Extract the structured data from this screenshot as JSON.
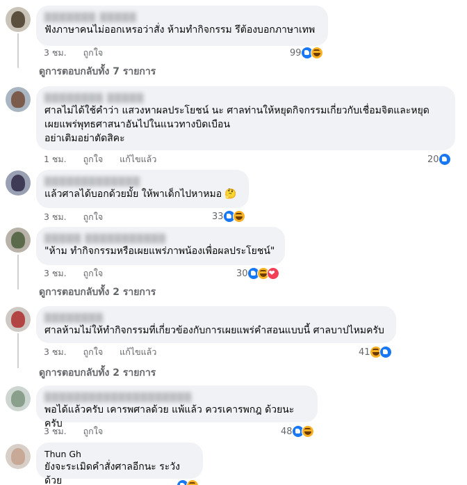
{
  "comments": [
    {
      "name": "▒▒▒▒▒▒▒ ▒▒▒▒▒",
      "text": "ฟังภาษาคนไม่ออกเหรอว่าสั่ง ห้ามทำกิจกรรม รึต้องบอกภาษาเทพ",
      "time": "3 ชม.",
      "like": "ถูกใจ",
      "edited": "",
      "reaction_count": "99",
      "reactions": [
        "like",
        "haha"
      ],
      "view_replies": "ดูการตอบกลับทั้ง 7 รายการ"
    },
    {
      "name": "▒▒▒▒▒▒▒▒ ▒▒▒▒▒",
      "text": "ศาลไม่ได้ใช้คำว่า แสวงหาผลประโยชน์ นะ ศาลท่านให้หยุดกิจกรรมเกี่ยวกับเชื่อมจิตและหยุด\nเผยแพร่พุทธศาสนาอันไปในแนวทางบิดเบือน\nอย่าเติมอย่าตัดสิคะ",
      "time": "1 ชม.",
      "like": "ถูกใจ",
      "edited": "แก้ไขแล้ว",
      "reaction_count": "20",
      "reactions": [
        "like"
      ],
      "view_replies": ""
    },
    {
      "name": "▒▒▒▒▒▒▒▒▒▒▒▒▒",
      "text": "แล้วศาลได้บอกด้วยมั้ย ให้พาเด็กไปหาหมอ",
      "time": "3 ชม.",
      "like": "ถูกใจ",
      "edited": "",
      "reaction_count": "33",
      "reactions": [
        "like",
        "haha"
      ],
      "view_replies": ""
    },
    {
      "name": "▒▒▒▒▒ ▒▒▒▒▒▒▒▒▒▒▒",
      "text": "\"ห้าม ทำกิจกรรมหรือเผยแพร่ภาพน้องเพื่อผลประโยชน์\"",
      "time": "3 ชม.",
      "like": "ถูกใจ",
      "edited": "",
      "reaction_count": "30",
      "reactions": [
        "like",
        "haha",
        "love"
      ],
      "view_replies": "ดูการตอบกลับทั้ง 2 รายการ"
    },
    {
      "name": "▒▒▒▒▒▒▒▒",
      "text": "ศาลห้ามไม่ให้ทำกิจกรรมที่เกี่ยวข้องกับการเผยแพร่คำสอนแบบนี้ ศาลบาปไหมครับ",
      "time": "3 ชม.",
      "like": "ถูกใจ",
      "edited": "แก้ไขแล้ว",
      "reaction_count": "41",
      "reactions": [
        "haha",
        "like"
      ],
      "view_replies": "ดูการตอบกลับทั้ง 2 รายการ"
    },
    {
      "name": "▒▒▒▒▒▒▒▒▒▒▒▒▒▒▒▒▒▒▒▒",
      "text": "พอได้แล้วครับ เคารพศาลด้วย แพ้แล้ว ควรเคารพกฎ ด้วยนะครับ",
      "time": "3 ชม.",
      "like": "ถูกใจ",
      "edited": "",
      "reaction_count": "48",
      "reactions": [
        "like",
        "haha"
      ],
      "view_replies": ""
    },
    {
      "name": "Thun Gh",
      "text": "ยังจะระเมิดคำสั่งศาลอีกนะ ระวังด้วย",
      "time": "",
      "like": "",
      "edited": "",
      "reaction_count": "",
      "reactions": [
        "like",
        "haha"
      ],
      "view_replies": ""
    }
  ],
  "colors": {
    "bubble_bg": "#f0f2f5",
    "meta_text": "#65676b",
    "like_blue": "#1877f2",
    "haha_yellow": "#f7b125",
    "love_red": "#f33e58"
  },
  "icons": {
    "think": "🤔"
  }
}
